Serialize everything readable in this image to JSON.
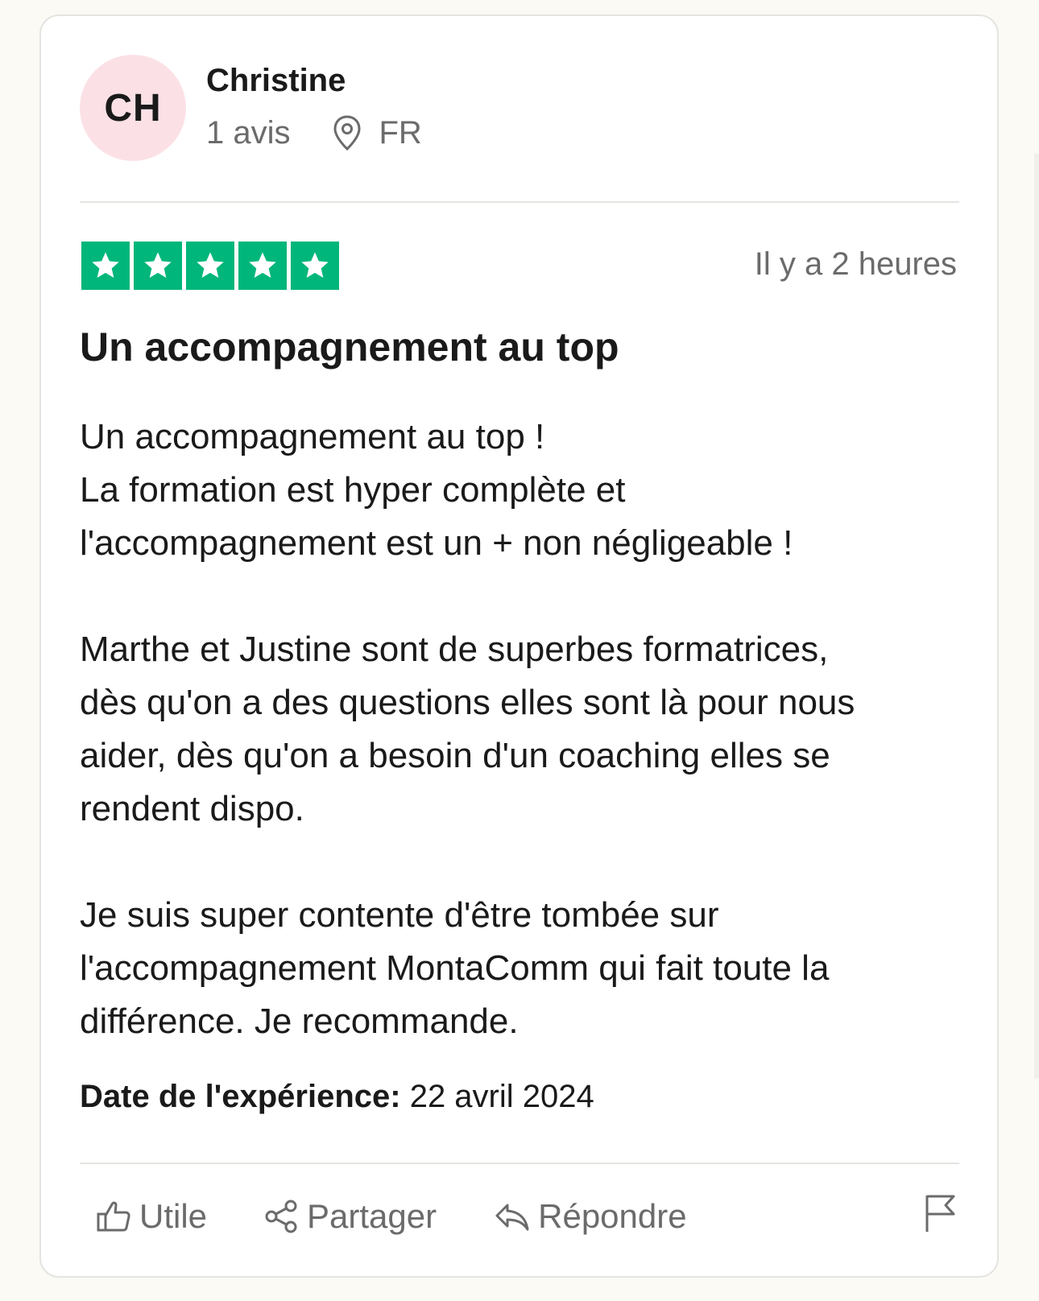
{
  "colors": {
    "star_green": "#00b67a",
    "avatar_bg": "#fbe1e6",
    "muted_text": "#6b6b6b"
  },
  "reviewer": {
    "initials": "CH",
    "name": "Christine",
    "review_count": "1 avis",
    "location_icon": "map-pin-icon",
    "country": "FR"
  },
  "rating": {
    "stars": 5,
    "max_stars": 5,
    "relative_date": "Il y a 2 heures"
  },
  "review": {
    "title": "Un accompagnement au top",
    "paragraphs": [
      [
        "Un accompagnement au top !",
        "La formation est hyper complète et",
        "l'accompagnement est un + non négligeable !"
      ],
      [
        "Marthe et Justine sont de superbes formatrices,",
        "dès qu'on a des questions elles sont là pour nous",
        "aider, dès qu'on a besoin d'un coaching elles se",
        "rendent dispo."
      ],
      [
        "Je suis super contente d'être tombée sur",
        "l'accompagnement MontaComm qui fait toute la",
        "différence. Je recommande."
      ]
    ],
    "experience_label": "Date de l'expérience:",
    "experience_date": "22 avril 2024"
  },
  "actions": {
    "useful_label": "Utile",
    "useful_icon": "thumbs-up-icon",
    "share_label": "Partager",
    "share_icon": "share-icon",
    "reply_label": "Répondre",
    "reply_icon": "reply-icon",
    "report_icon": "flag-icon"
  }
}
